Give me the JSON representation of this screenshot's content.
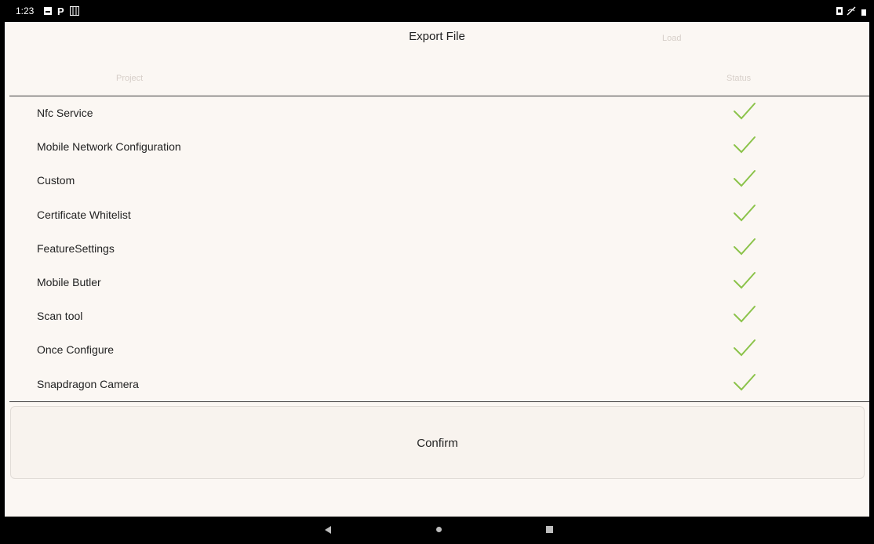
{
  "statusbar": {
    "time": "1:23"
  },
  "header": {
    "title": "Export File",
    "faded_right": "Load",
    "column_left": "Project",
    "column_right": "Status"
  },
  "rows": [
    {
      "label": "Nfc Service",
      "status": "check"
    },
    {
      "label": "Mobile Network Configuration",
      "status": "check"
    },
    {
      "label": "Custom",
      "status": "check"
    },
    {
      "label": "Certificate Whitelist",
      "status": "check"
    },
    {
      "label": "FeatureSettings",
      "status": "check"
    },
    {
      "label": "Mobile Butler",
      "status": "check"
    },
    {
      "label": "Scan tool",
      "status": "check"
    },
    {
      "label": "Once Configure",
      "status": "check"
    },
    {
      "label": "Snapdragon Camera",
      "status": "check"
    }
  ],
  "confirm_label": "Confirm",
  "colors": {
    "check": "#8bc34a",
    "background": "#fbf7f3"
  }
}
